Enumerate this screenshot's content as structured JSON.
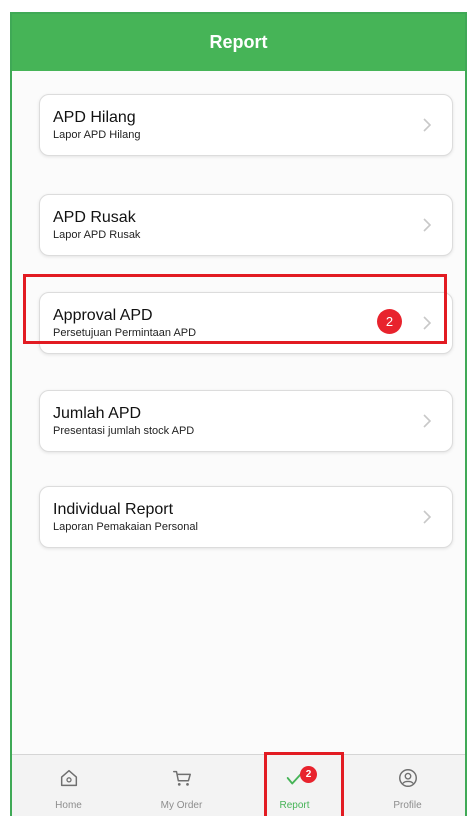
{
  "header": {
    "title": "Report"
  },
  "menu": [
    {
      "title": "APD Hilang",
      "subtitle": "Lapor APD Hilang"
    },
    {
      "title": "APD Rusak",
      "subtitle": "Lapor APD Rusak"
    },
    {
      "title": "Approval APD",
      "subtitle": "Persetujuan Permintaan APD",
      "badge": "2"
    },
    {
      "title": "Jumlah APD",
      "subtitle": "Presentasi jumlah stock APD"
    },
    {
      "title": "Individual Report",
      "subtitle": "Laporan Pemakaian Personal"
    }
  ],
  "tabbar": {
    "tabs": [
      {
        "label": "Home",
        "icon": "home-icon"
      },
      {
        "label": "My Order",
        "icon": "cart-icon"
      },
      {
        "label": "Report",
        "icon": "check-icon",
        "badge": "2",
        "active": true
      },
      {
        "label": "Profile",
        "icon": "profile-icon"
      }
    ]
  },
  "colors": {
    "header": "#46b457",
    "badge": "#e8232d",
    "highlight": "#e21b22",
    "active_tab": "#46b457"
  }
}
